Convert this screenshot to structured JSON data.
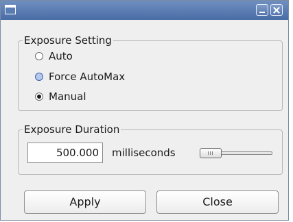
{
  "window": {
    "title": "",
    "controls": [
      "minimize-icon",
      "close-icon"
    ],
    "accent_color": "#5676ae"
  },
  "exposure_setting": {
    "group_title": "Exposure Setting",
    "options": [
      {
        "label": "Auto",
        "checked": false
      },
      {
        "label": "Force AutoMax",
        "checked": false
      },
      {
        "label": "Manual",
        "checked": true
      }
    ]
  },
  "exposure_duration": {
    "group_title": "Exposure Duration",
    "value": "500.000",
    "unit": "milliseconds",
    "slider_level": 0
  },
  "buttons": {
    "apply_label": "Apply",
    "close_label": "Close"
  }
}
